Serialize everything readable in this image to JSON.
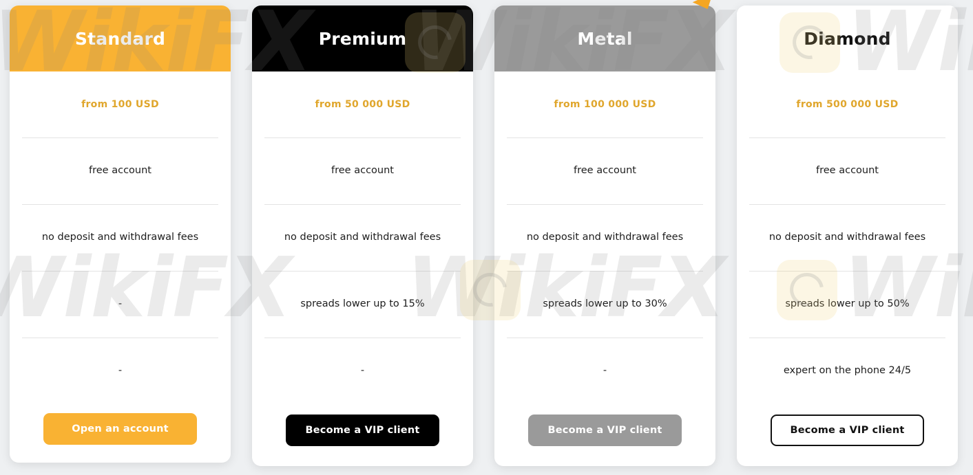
{
  "page": {
    "background_color": "#eef0f2",
    "accent_color": "#f9ad2b",
    "price_color": "#e0a62c"
  },
  "promo_pointer": {
    "name": "promo-arrow",
    "color": "#f5a623"
  },
  "watermarks": {
    "text": "WikiFX",
    "logo_name": "wikifx-logo-watermark"
  },
  "plans": [
    {
      "id": "standard",
      "title": "Standard",
      "header_bg": "#f9b233",
      "header_text_color": "#ffffff",
      "price": "from 100 USD",
      "features": [
        "free account",
        "no deposit and withdrawal fees",
        "-",
        "-"
      ],
      "cta": {
        "label": "Open an account",
        "bg": "#f9b233",
        "text_color": "#ffffff",
        "border": "none"
      }
    },
    {
      "id": "premium",
      "title": "Premium",
      "header_bg": "#000000",
      "header_text_color": "#ffffff",
      "price": "from 50 000 USD",
      "features": [
        "free account",
        "no deposit and withdrawal fees",
        "spreads lower up to 15%",
        "-"
      ],
      "cta": {
        "label": "Become a VIP client",
        "bg": "#000000",
        "text_color": "#ffffff",
        "border": "none"
      }
    },
    {
      "id": "metal",
      "title": "Metal",
      "header_bg": "#9a9a9a",
      "header_text_color": "#ffffff",
      "price": "from 100 000 USD",
      "features": [
        "free account",
        "no deposit and withdrawal fees",
        "spreads lower up to 30%",
        "-"
      ],
      "cta": {
        "label": "Become a VIP client",
        "bg": "#9a9a9a",
        "text_color": "#ffffff",
        "border": "none"
      }
    },
    {
      "id": "diamond",
      "title": "Diamond",
      "header_bg": "#ffffff",
      "header_text_color": "#111111",
      "price": "from 500 000 USD",
      "features": [
        "free account",
        "no deposit and withdrawal fees",
        "spreads lower up to 50%",
        "expert on the phone 24/5"
      ],
      "cta": {
        "label": "Become a VIP client",
        "bg": "#ffffff",
        "text_color": "#111111",
        "border": "2px solid #111111"
      }
    }
  ]
}
